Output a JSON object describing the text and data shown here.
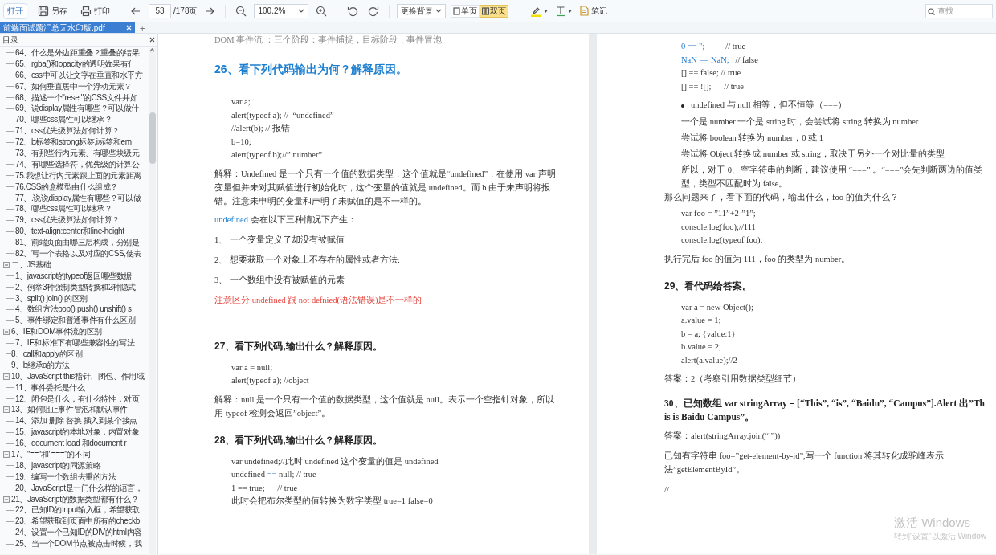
{
  "toolbar": {
    "groups": [
      [
        {
          "kind": "open",
          "label": "打开"
        },
        {
          "kind": "save",
          "label": "另存"
        },
        {
          "kind": "print",
          "label": "打印"
        }
      ],
      [
        {
          "kind": "prev"
        },
        {
          "kind": "page_field",
          "value": "53"
        },
        {
          "kind": "page_total",
          "label": "/178页"
        },
        {
          "kind": "next"
        }
      ],
      [
        {
          "kind": "zoom_out"
        },
        {
          "kind": "zoom_select",
          "value": "100.2%"
        },
        {
          "kind": "zoom_in"
        }
      ],
      [
        {
          "kind": "rotate_left"
        },
        {
          "kind": "rotate_right"
        }
      ],
      [
        {
          "kind": "select",
          "label": "更换背景"
        },
        {
          "kind": "view",
          "label": "单页",
          "selected": false
        },
        {
          "kind": "view",
          "label": "双页",
          "selected": true
        }
      ],
      [
        {
          "kind": "highlight"
        },
        {
          "kind": "text_tool"
        },
        {
          "kind": "note",
          "label": "笔记"
        }
      ]
    ],
    "search": {
      "placeholder": "查找"
    }
  },
  "tabs": [
    {
      "label": "前端面试题汇总无水印版.pdf",
      "selected": true
    }
  ],
  "new_tab": "+",
  "sidebar": {
    "title": "目录",
    "items": [
      {
        "children": [
          {
            "label": "64、什么是外边距重叠？重叠的结果"
          },
          {
            "label": "65、rgba()和opacity的透明效果有什"
          },
          {
            "label": "66、css中可以让文字在垂直和水平方"
          },
          {
            "label": "67、如何垂直居中一个浮动元素？"
          },
          {
            "label": "68、描述一个\"reset\"的CSS文件并如"
          },
          {
            "label": "69、说display属性有哪些？可以做什"
          },
          {
            "label": "70、哪些css属性可以继承？"
          },
          {
            "label": "71、css优先级算法如何计算？"
          },
          {
            "label": "72、b标签和strong标签,i标签和em"
          },
          {
            "label": "73、有那些行内元素、有哪些块级元"
          },
          {
            "label": "74、有哪些选择符，优先级的计算公"
          },
          {
            "label": "75.我想让行内元素跟上面的元素距离"
          },
          {
            "label": "76.CSS的盒模型由什么组成？"
          },
          {
            "label": "77、.说说display属性有哪些？可以做"
          },
          {
            "label": "78、哪些css属性可以继承？"
          },
          {
            "label": "79、css优先级算法如何计算？"
          },
          {
            "label": "80、text-align:center和line-height"
          },
          {
            "label": "81、前端页面由哪三层构成，分别是"
          },
          {
            "label": "82、写一个表格以及对应的CSS,使表"
          }
        ]
      },
      {
        "label": "二、JS基础",
        "expanded": true,
        "children": [
          {
            "label": "1、javascript的typeof返回哪些数据"
          },
          {
            "label": "2、例举3种强制类型转换和2种隐式"
          },
          {
            "label": "3、split() join() 的区别"
          },
          {
            "label": "4、数组方法pop() push() unshift() s"
          },
          {
            "label": "5、事件绑定和普通事件有什么区别"
          }
        ]
      },
      {
        "label": "6、IE和DOM事件流的区别",
        "expanded": true,
        "children": [
          {
            "label": "7、IE和标准下有哪些兼容性的写法"
          }
        ]
      },
      {
        "label": "8、call和apply的区别"
      },
      {
        "label": "9、b继承a的方法"
      },
      {
        "label": "10、JavaScript this指针、闭包、作用域",
        "expanded": true,
        "children": [
          {
            "label": "11、事件委托是什么"
          },
          {
            "label": "12、闭包是什么，有什么特性，对页"
          }
        ]
      },
      {
        "label": "13、如何阻止事件冒泡和默认事件",
        "expanded": true,
        "children": [
          {
            "label": "14、添加 删除 替换 插入到某个接点"
          },
          {
            "label": "15、javascript的本地对象，内置对象"
          },
          {
            "label": "16、document load 和document r"
          }
        ]
      },
      {
        "label": "17、\"==\"和\"===\"的不同",
        "expanded": true,
        "children": [
          {
            "label": "18、javascript的同源策略"
          },
          {
            "label": "19、编写一个数组去重的方法"
          },
          {
            "label": "20、JavaScript是一门什么样的语言，"
          }
        ]
      },
      {
        "label": "21、JavaScript的数据类型都有什么？",
        "expanded": true,
        "children": [
          {
            "label": "22、已知ID的Input输入框，希望获取"
          },
          {
            "label": "23、希望获取到页面中所有的checkb"
          },
          {
            "label": "24、设置一个已知ID的DIV的html内容"
          },
          {
            "label": "25、当一个DOM节点被点击时候，我"
          }
        ]
      }
    ]
  },
  "pages": [
    {
      "blocks": [
        {
          "kind": "cut",
          "text": "DOM 事件流 ：三个阶段：事件捕捉，目标阶段，事件冒泡"
        },
        {
          "kind": "title",
          "text": "26、看下列代码输出为何？解释原因。"
        },
        {
          "kind": "code",
          "lines": [
            {
              "text": "var a;"
            },
            {
              "text": "alert(typeof a); //  “undefined”"
            },
            {
              "text": "//alert(b); // 报错"
            },
            {
              "text": "b=10;"
            },
            {
              "text": "alert(typeof b);//” number”"
            }
          ]
        },
        {
          "kind": "para",
          "text": "解释：Undefined 是一个只有一个值的数据类型，这个值就是“undefined”，在使用 var 声明变量但并未对其赋值进行初始化时，这个变量的值就是 undefined。而 b 由于未声明将报错。注意未申明的变量和声明了未赋值的是不一样的。"
        },
        {
          "kind": "para",
          "lead": "undefined",
          "text": "会在以下三种情况下产生："
        },
        {
          "kind": "para",
          "text": "1、 一个变量定义了却没有被赋值"
        },
        {
          "kind": "para",
          "text": "2、 想要获取一个对象上不存在的属性或者方法:"
        },
        {
          "kind": "para",
          "text": "3、 一个数组中没有被赋值的元素"
        },
        {
          "kind": "note",
          "text": "注意区分 undefined 跟 not defnied(语法错误)是不一样的"
        },
        {
          "kind": "heading",
          "text": "27、看下列代码,输出什么？解释原因。"
        },
        {
          "kind": "code",
          "lines": [
            {
              "text": "var a = null;"
            },
            {
              "text": "alert(typeof a); //object"
            }
          ]
        },
        {
          "kind": "para",
          "text": "解释：null 是一个只有一个值的数据类型，这个值就是 null。表示一个空指针对象，所以用 typeof 检测会返回”object”。"
        },
        {
          "kind": "heading",
          "text": "28、看下列代码,输出什么？解释原因。"
        },
        {
          "kind": "code",
          "lines": [
            {
              "text": "var undefined;//此时 undefined 这个变量的值是 undefined"
            },
            {
              "parts": [
                {
                  "text": "undefined ",
                  "highlight": false
                },
                {
                  "text": "==",
                  "highlight": true
                },
                {
                  "text": " null; // true",
                  "highlight": false
                }
              ]
            },
            {
              "text": "1 == true;      // true"
            },
            {
              "text": "此时会把布尔类型的值转换为数字类型 true=1 false=0"
            }
          ]
        }
      ]
    },
    {
      "blocks": [
        {
          "kind": "code",
          "lines": [
            {
              "parts": [
                {
                  "text": "0 == '';",
                  "highlight": true
                },
                {
                  "text": "          // true",
                  "highlight": false
                }
              ]
            },
            {
              "parts": [
                {
                  "text": "NaN == NaN;",
                  "highlight": true
                },
                {
                  "text": "   // false",
                  "highlight": false
                }
              ]
            },
            {
              "text": "[] == false; // true"
            },
            {
              "text": "[] == ![];      // true"
            }
          ]
        },
        {
          "kind": "bullet",
          "text": "undefined 与 null 相等，但不恒等（===）"
        },
        {
          "kind": "indent",
          "text": "一个是 number 一个是 string 时，会尝试将 string 转换为 number"
        },
        {
          "kind": "indent",
          "text": "尝试将 boolean 转换为 number，0 或 1"
        },
        {
          "kind": "indent",
          "text": "尝试将 Object 转换成 number 或 string，取决于另外一个对比量的类型"
        },
        {
          "kind": "indent",
          "text": "所以，对于 0、空字符串的判断，建议使用 “===” 。“===”会先判断两边的值类型，类型不匹配时为 false。"
        },
        {
          "kind": "para",
          "text": "那么问题来了，看下面的代码，输出什么，foo 的值为什么？"
        },
        {
          "kind": "code",
          "lines": [
            {
              "text": "var foo = ”11”+2-”1”;"
            },
            {
              "text": "console.log(foo);//111"
            },
            {
              "text": "console.log(typeof foo);"
            }
          ]
        },
        {
          "kind": "para",
          "text": "执行完后 foo 的值为 111，foo 的类型为 number。"
        },
        {
          "kind": "heading",
          "text": "29、看代码给答案。"
        },
        {
          "kind": "code",
          "lines": [
            {
              "text": "var a = new Object();"
            },
            {
              "text": "a.value = 1;"
            },
            {
              "text": "b = a; {value:1}"
            },
            {
              "text": "b.value = 2;"
            },
            {
              "text": "alert(a.value);//2"
            }
          ]
        },
        {
          "kind": "para",
          "text": "答案：2（考察引用数据类型细节）"
        },
        {
          "kind": "spread_heading",
          "text": "30、已知数组 var stringArray = [“This”, “is”, “Baidu”, “Campus”].Alert 出”This is Baidu Campus”。"
        },
        {
          "kind": "para",
          "text": "答案：alert(stringArray.join(“ ”))"
        },
        {
          "kind": "para",
          "text": "已知有字符串 foo=”get-element-by-id”,写一个 function 将其转化成驼峰表示法”getElementById”。"
        },
        {
          "kind": "para",
          "text": "//"
        }
      ]
    }
  ],
  "activation": {
    "title": "激活 Windows",
    "hint": "转到“设置”以激活 Window"
  }
}
